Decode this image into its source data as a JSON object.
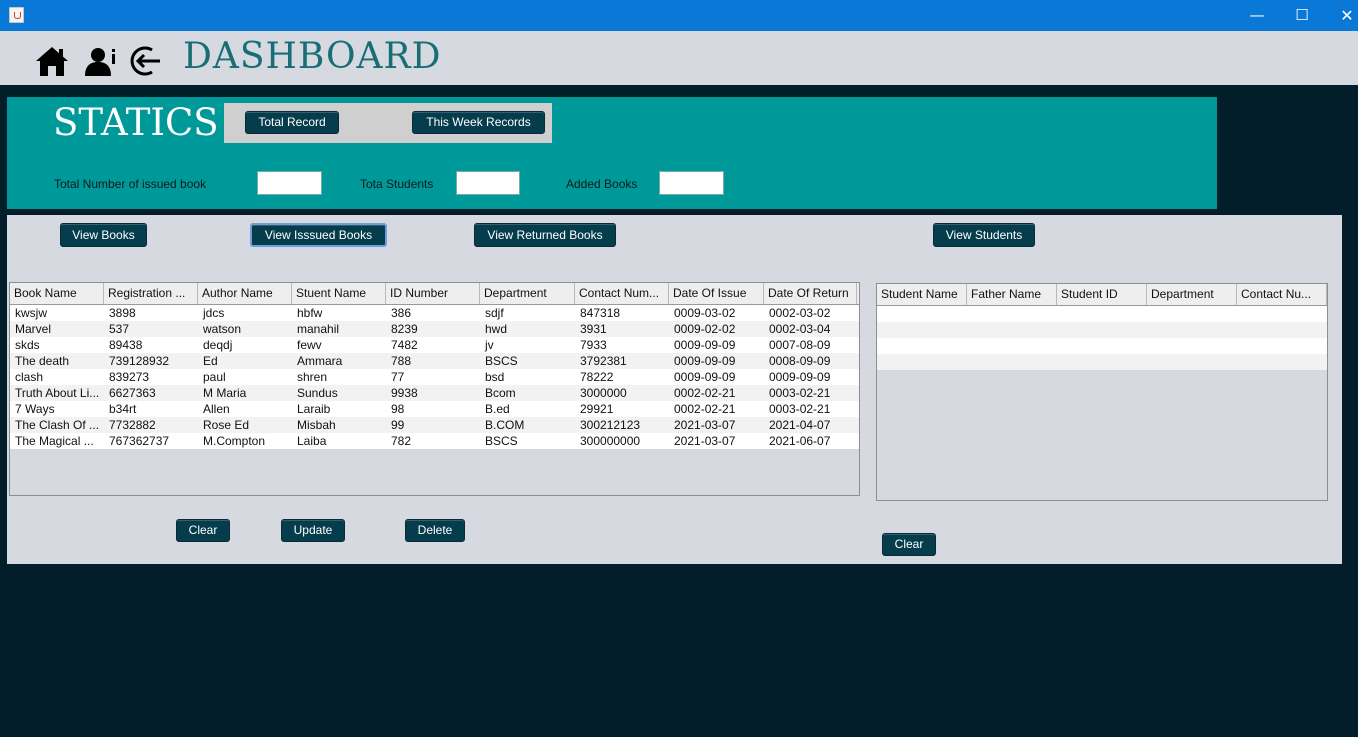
{
  "window": {
    "minimize_glyph": "—",
    "maximize_glyph": "☐",
    "close_glyph": "✕"
  },
  "header": {
    "title": "DASHBOARD",
    "icons": [
      "home-icon",
      "user-info-icon",
      "logout-icon"
    ]
  },
  "statics": {
    "title": "STATICS",
    "total_record_label": "Total Record",
    "week_records_label": "This Week Records",
    "issued_label": "Total Number of issued book",
    "students_label": "Tota Students",
    "added_label": "Added Books",
    "issued_value": "",
    "students_value": "",
    "added_value": ""
  },
  "nav": {
    "view_books": "View Books",
    "view_issued": "View Isssued Books",
    "view_returned": "View Returned Books",
    "view_students": "View Students"
  },
  "books_table": {
    "columns": [
      "Book Name",
      "Registration ...",
      "Author Name",
      "Stuent Name",
      "ID Number",
      "Department",
      "Contact Num...",
      "Date Of Issue",
      "Date Of Return"
    ],
    "rows": [
      [
        "kwsjw",
        "3898",
        "jdcs",
        "hbfw",
        "386",
        "sdjf",
        "847318",
        "0009-03-02",
        "0002-03-02"
      ],
      [
        "Marvel",
        "537",
        "watson",
        "manahil",
        "8239",
        "hwd",
        "3931",
        "0009-02-02",
        "0002-03-04"
      ],
      [
        "skds",
        "89438",
        "deqdj",
        "fewv",
        "7482",
        "jv",
        "7933",
        "0009-09-09",
        "0007-08-09"
      ],
      [
        "The death",
        "739128932",
        "Ed",
        "Ammara",
        "788",
        "BSCS",
        "3792381",
        "0009-09-09",
        "0008-09-09"
      ],
      [
        "clash",
        "839273",
        "paul",
        "shren",
        "77",
        "bsd",
        "78222",
        "0009-09-09",
        "0009-09-09"
      ],
      [
        "Truth About Li...",
        "6627363",
        "M Maria",
        "Sundus",
        "9938",
        "Bcom",
        "3000000",
        "0002-02-21",
        "0003-02-21"
      ],
      [
        "7 Ways",
        "b34rt",
        "Allen",
        "Laraib",
        "98",
        "B.ed",
        "29921",
        "0002-02-21",
        "0003-02-21"
      ],
      [
        "The Clash Of ...",
        "7732882",
        "Rose Ed",
        "Misbah",
        "99",
        "B.COM",
        "300212123",
        "2021-03-07",
        "2021-04-07"
      ],
      [
        "The Magical ...",
        "767362737",
        "M.Compton",
        "Laiba",
        "782",
        "BSCS",
        "300000000",
        "2021-03-07",
        "2021-06-07"
      ]
    ],
    "clear_label": "Clear",
    "update_label": "Update",
    "delete_label": "Delete"
  },
  "students_table": {
    "columns": [
      "Student Name",
      "Father Name",
      "Student ID",
      "Department",
      "Contact Nu..."
    ],
    "empty_rows": 4,
    "clear_label": "Clear"
  }
}
